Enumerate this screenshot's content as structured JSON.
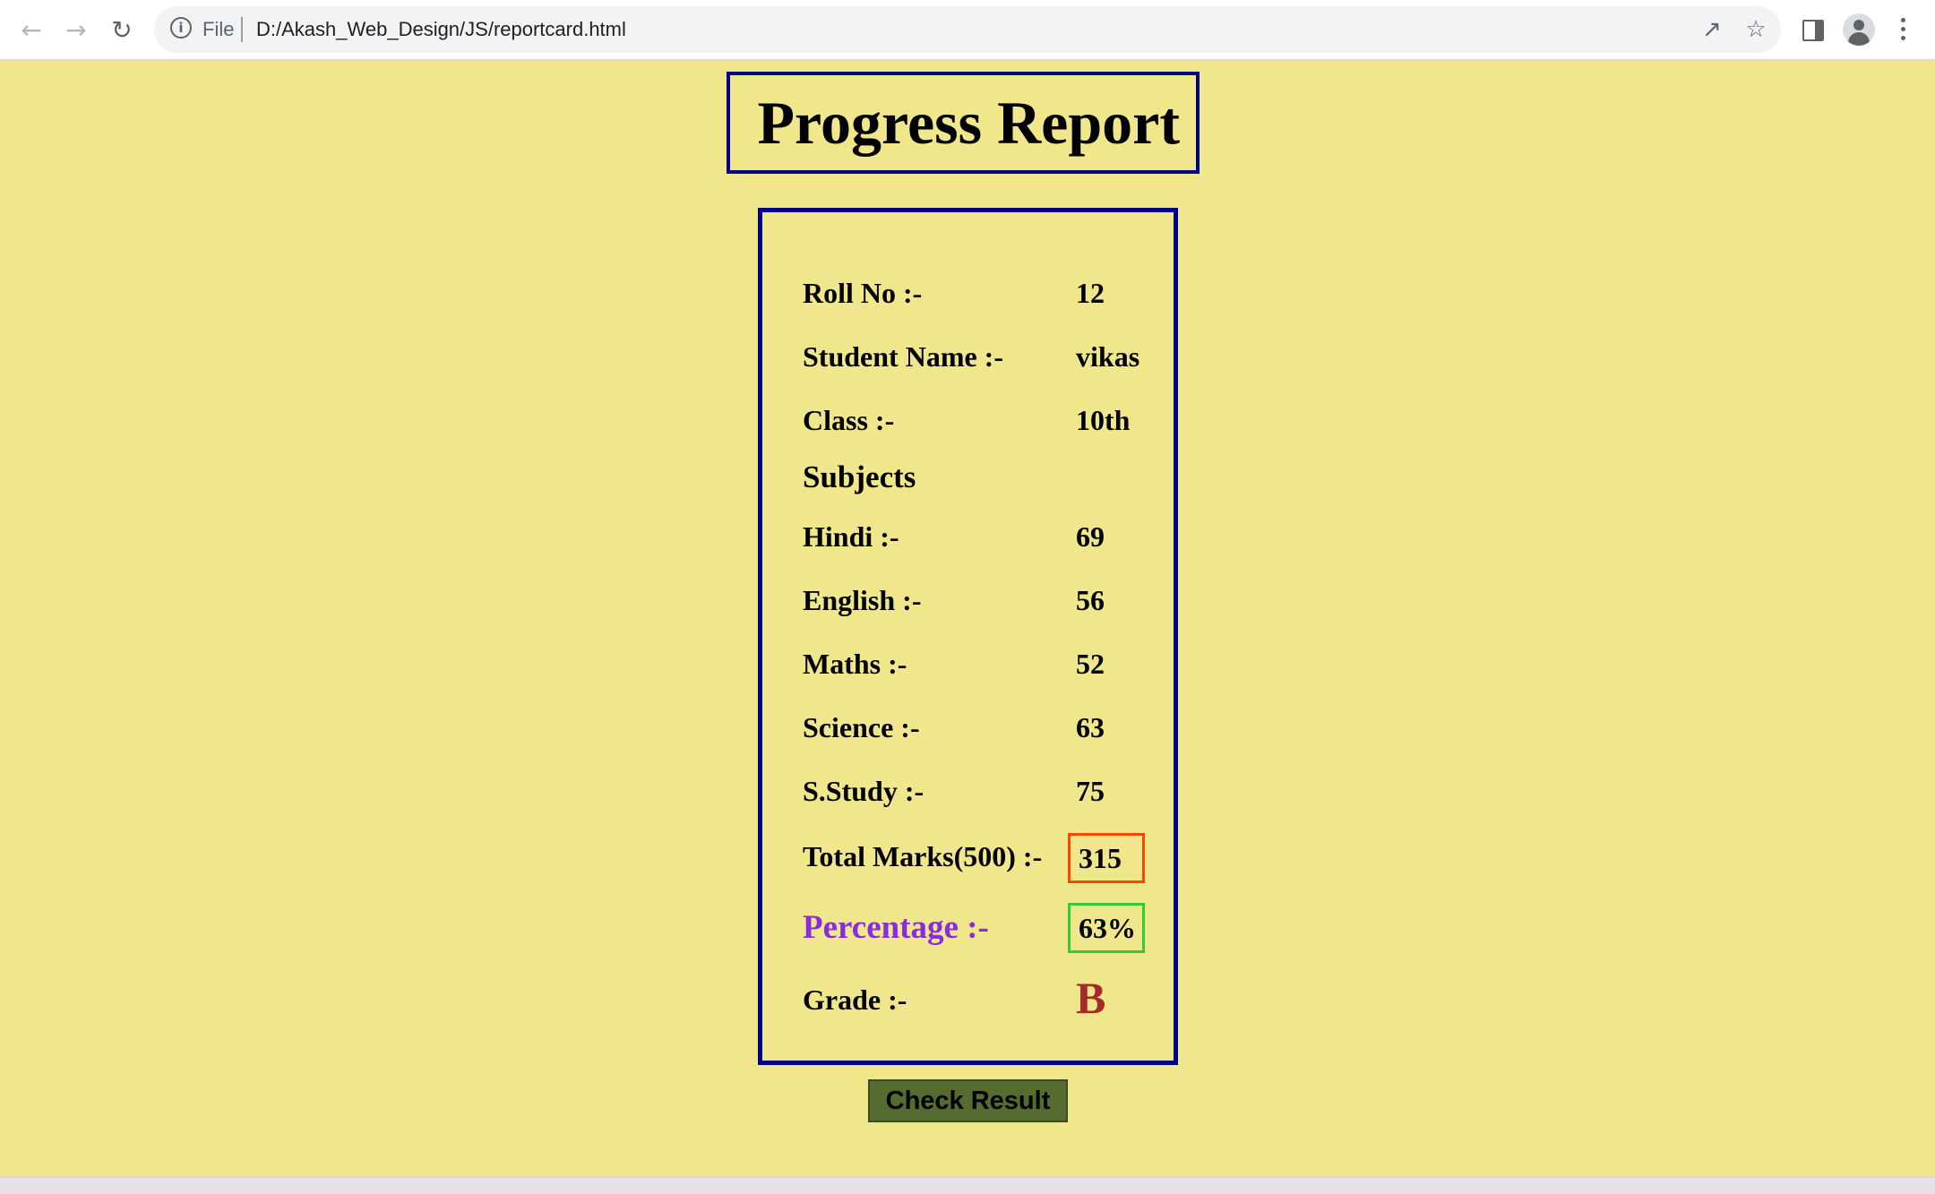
{
  "browser": {
    "scheme_label": "File",
    "url": "D:/Akash_Web_Design/JS/reportcard.html"
  },
  "page": {
    "title": "Progress Report",
    "rows": {
      "roll_label": "Roll No :-",
      "roll_value": "12",
      "name_label": "Student Name :-",
      "name_value": "vikas",
      "class_label": "Class :-",
      "class_value": "10th",
      "subjects_heading": "Subjects",
      "hindi_label": "Hindi :-",
      "hindi_value": "69",
      "english_label": "English :-",
      "english_value": "56",
      "maths_label": "Maths :-",
      "maths_value": "52",
      "science_label": "Science :-",
      "science_value": "63",
      "sstudy_label": "S.Study :-",
      "sstudy_value": "75",
      "total_label": "Total Marks(500) :-",
      "total_value": "315",
      "percentage_label": "Percentage :-",
      "percentage_value": "63%",
      "grade_label": "Grade :-",
      "grade_value": "B"
    },
    "check_button": "Check Result"
  },
  "colors": {
    "background": "#f0e68c",
    "border": "#00008b",
    "percentage_label": "#8a2be2",
    "grade": "#a52a2a",
    "total_box": "#ff4500",
    "percentage_box": "#32cd32",
    "button": "#556b2f"
  }
}
